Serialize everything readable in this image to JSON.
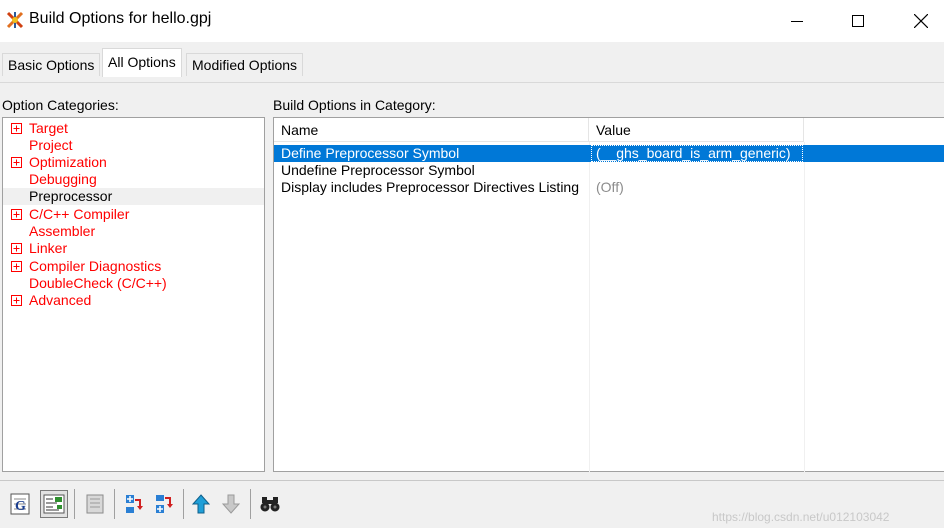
{
  "window": {
    "title": "Build Options for hello.gpj"
  },
  "tabs": [
    {
      "label": "Basic Options",
      "active": false
    },
    {
      "label": "All Options",
      "active": true
    },
    {
      "label": "Modified Options",
      "active": false
    }
  ],
  "categories_panel": {
    "label": "Option Categories:",
    "items": [
      {
        "label": "Target",
        "expandable": true,
        "selected": false
      },
      {
        "label": "Project",
        "expandable": false,
        "selected": false
      },
      {
        "label": "Optimization",
        "expandable": true,
        "selected": false
      },
      {
        "label": "Debugging",
        "expandable": false,
        "selected": false
      },
      {
        "label": "Preprocessor",
        "expandable": false,
        "selected": true
      },
      {
        "label": "C/C++ Compiler",
        "expandable": true,
        "selected": false
      },
      {
        "label": "Assembler",
        "expandable": false,
        "selected": false
      },
      {
        "label": "Linker",
        "expandable": true,
        "selected": false
      },
      {
        "label": "Compiler Diagnostics",
        "expandable": true,
        "selected": false
      },
      {
        "label": "DoubleCheck (C/C++)",
        "expandable": false,
        "selected": false
      },
      {
        "label": "Advanced",
        "expandable": true,
        "selected": false
      }
    ]
  },
  "options_panel": {
    "label": "Build Options in Category:",
    "columns": {
      "name": "Name",
      "value": "Value"
    },
    "rows": [
      {
        "name": "Define Preprocessor Symbol",
        "value": "(__ghs_board_is_arm_generic)",
        "selected": true
      },
      {
        "name": "Undefine Preprocessor Symbol",
        "value": "",
        "selected": false
      },
      {
        "name": "Display includes Preprocessor Directives Listing",
        "value": "(Off)",
        "selected": false
      }
    ]
  },
  "toolbar": {
    "buttons": [
      {
        "icon": "set-option-icon"
      },
      {
        "icon": "show-description-icon",
        "pressed": true
      },
      {
        "icon": "notes-icon",
        "disabled": true
      },
      {
        "icon": "add-before-icon"
      },
      {
        "icon": "add-after-icon"
      },
      {
        "icon": "move-up-icon"
      },
      {
        "icon": "move-down-icon",
        "disabled": true
      },
      {
        "icon": "search-icon"
      }
    ]
  },
  "colors": {
    "category_text": "#ff0000",
    "selection": "#0078d7",
    "dialog_bg": "#f0f0f0"
  },
  "watermark": "https://blog.csdn.net/u012103042"
}
